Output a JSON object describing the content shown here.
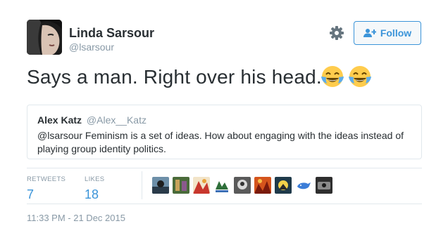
{
  "author": {
    "name": "Linda Sarsour",
    "handle": "@lsarsour"
  },
  "actions": {
    "follow_label": "Follow"
  },
  "tweet": {
    "text": "Says a man. Right over his head.",
    "emojis": [
      "face-with-tears-of-joy",
      "face-with-tears-of-joy"
    ]
  },
  "quote": {
    "name": "Alex Katz",
    "handle": "@Alex__Katz",
    "text": "@lsarsour Feminism is a set of ideas. How about engaging with the ideas instead of playing group identity politics."
  },
  "stats": {
    "retweets_label": "RETWEETS",
    "retweets_value": "7",
    "likes_label": "LIKES",
    "likes_value": "18"
  },
  "timestamp": "11:33 PM - 21 Dec 2015",
  "colors": {
    "accent": "#3b94d9",
    "text": "#292f33",
    "muted": "#8899a6",
    "border": "#e1e8ed"
  }
}
